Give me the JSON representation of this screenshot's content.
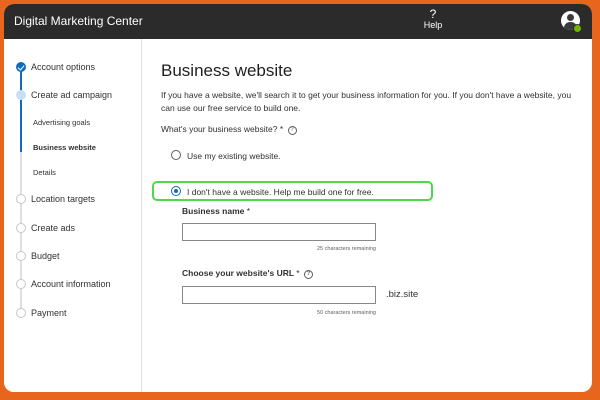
{
  "header": {
    "app_title": "Digital Marketing Center",
    "help_label": "Help",
    "help_icon": "?"
  },
  "sidebar": {
    "steps": [
      {
        "label": "Account options",
        "state": "done"
      },
      {
        "label": "Create ad campaign",
        "state": "in-progress"
      },
      {
        "label": "Location targets",
        "state": "todo"
      },
      {
        "label": "Create ads",
        "state": "todo"
      },
      {
        "label": "Budget",
        "state": "todo"
      },
      {
        "label": "Account information",
        "state": "todo"
      },
      {
        "label": "Payment",
        "state": "todo"
      }
    ],
    "substeps": [
      {
        "label": "Advertising goals"
      },
      {
        "label": "Business website",
        "active": true
      },
      {
        "label": "Details"
      }
    ]
  },
  "main": {
    "title": "Business website",
    "intro": "If you have a website, we'll search it to get your business information for you. If you don't have a website, you can use our free service to build one.",
    "question": "What's your business website?",
    "question_required": "*",
    "info_icon": "?",
    "options": [
      {
        "label": "Use my existing website.",
        "selected": false
      },
      {
        "label": "I don't have a website. Help me build one for free.",
        "selected": true
      }
    ],
    "business_name": {
      "label": "Business name",
      "required": "*",
      "value": "",
      "hint": "25 characters remaining"
    },
    "website_url": {
      "label": "Choose your website's URL",
      "required": "*",
      "value": "",
      "suffix": ".biz.site",
      "hint": "50 characters remaining"
    }
  },
  "colors": {
    "frame": "#e8651d",
    "topbar": "#2b2b2b",
    "accent": "#0f6cbd",
    "highlight": "#4cd94c",
    "presence": "#6bb700"
  }
}
